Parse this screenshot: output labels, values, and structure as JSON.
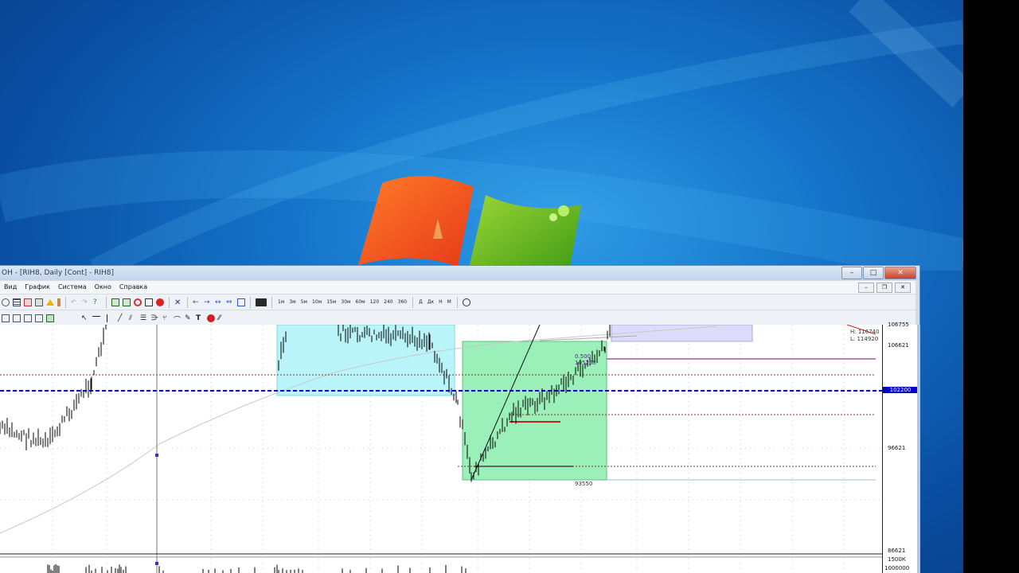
{
  "window": {
    "title": "ОН - [RIH8, Daily [Cont] - RIH8]",
    "controls": {
      "minimize": "–",
      "maximize": "□",
      "close": "✕"
    }
  },
  "menu": {
    "items": [
      "Вид",
      "График",
      "Система",
      "Окно",
      "Справка"
    ],
    "mdi": {
      "minimize": "–",
      "restore": "❐",
      "close": "✕"
    }
  },
  "toolbar": {
    "timeframes": [
      "1м",
      "3м",
      "5м",
      "10м",
      "15м",
      "30м",
      "60м",
      "120",
      "240",
      "360"
    ],
    "periods": [
      "Д",
      "Дк",
      "Н",
      "М"
    ]
  },
  "chart": {
    "price_labels": [
      "106755",
      "106621",
      "102200",
      "96621",
      "86621",
      "1500К",
      "1000000"
    ],
    "current_price": "102200",
    "hl_box": {
      "high": "H: 116740",
      "low": "L: 114920"
    },
    "fib_label": "0.500",
    "fib_value": "105268",
    "low_label": "93550",
    "colors": {
      "cyan_zone": "#b8f4f8",
      "green_zone": "#9af0b8",
      "lavender_zone": "#dcdcfa",
      "current_line": "#0000c8",
      "level_line": "#8b3a1a"
    }
  }
}
